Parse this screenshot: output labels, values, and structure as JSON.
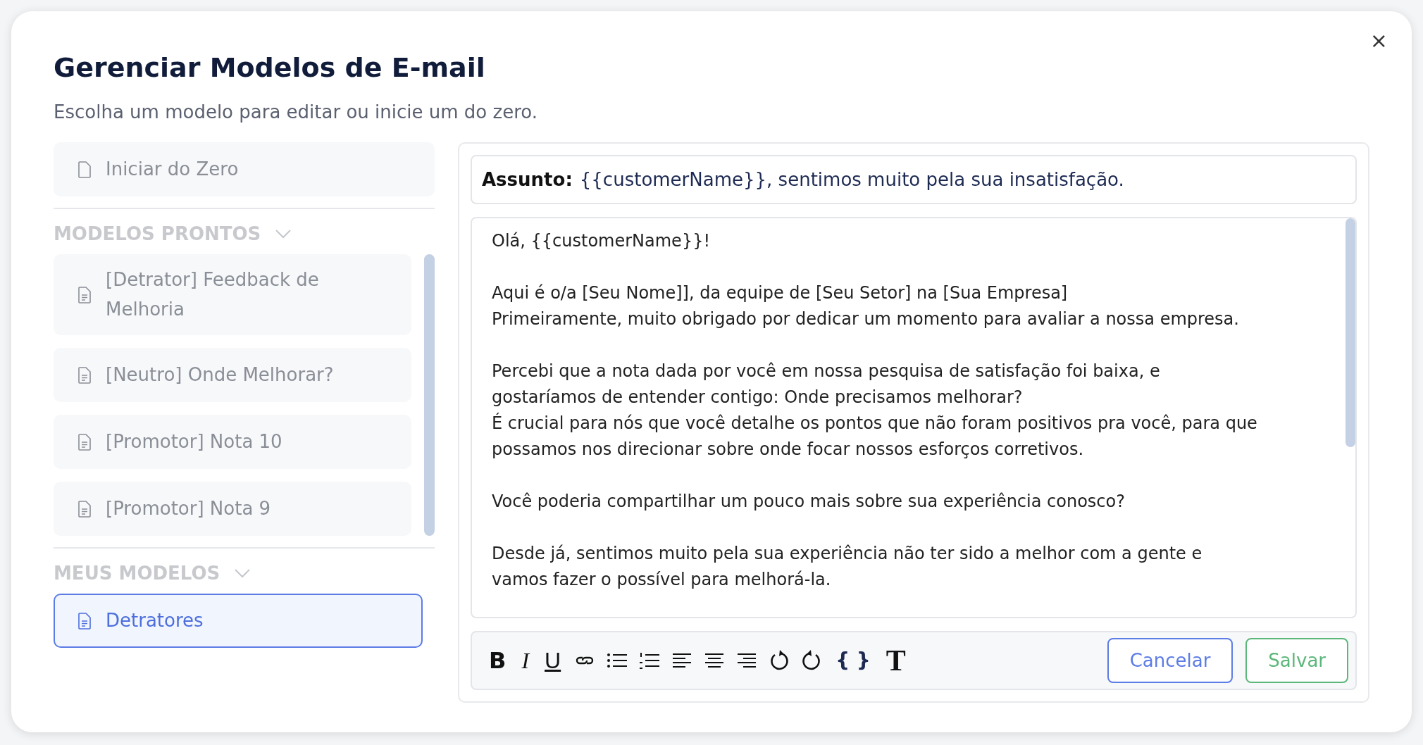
{
  "dialog": {
    "title": "Gerenciar Modelos de E-mail",
    "subtitle": "Escolha um modelo para editar ou inicie um do zero.",
    "close": "×"
  },
  "start_item": {
    "label": "Iniciar do Zero",
    "selected": false
  },
  "sections": [
    {
      "title": "MODELOS PRONTOS",
      "expanded": true,
      "scrollable": true,
      "items": [
        {
          "label": "[Detrator] Feedback de Melhoria",
          "selected": false
        },
        {
          "label": "[Neutro] Onde Melhorar?",
          "selected": false
        },
        {
          "label": "[Promotor] Nota 10",
          "selected": false
        },
        {
          "label": "[Promotor] Nota 9",
          "selected": false
        }
      ]
    },
    {
      "title": "MEUS MODELOS",
      "expanded": true,
      "scrollable": false,
      "items": [
        {
          "label": "Detratores",
          "selected": true
        }
      ]
    }
  ],
  "editor": {
    "subject_label": "Assunto:",
    "subject": "{{customerName}}, sentimos muito pela sua insatisfação.",
    "body": [
      [
        "Olá, {{customerName}}!"
      ],
      [
        "Aqui é o/a [Seu Nome]], da equipe de [Seu Setor]  na [Sua Empresa]",
        "Primeiramente, muito obrigado por dedicar um momento para avaliar a nossa empresa."
      ],
      [
        "Percebi que a nota dada por você em nossa pesquisa de satisfação foi baixa, e",
        "gostaríamos de entender contigo: Onde precisamos melhorar?",
        "É crucial para nós que você detalhe os pontos que não foram positivos pra você, para que",
        "possamos nos direcionar sobre onde focar nossos esforços corretivos."
      ],
      [
        "Você poderia compartilhar um pouco mais sobre sua experiência conosco?"
      ],
      [
        "Desde já, sentimos muito pela sua experiência não ter sido a melhor com a gente e",
        "vamos fazer o possível para melhorá-la."
      ]
    ],
    "toolbar": [
      {
        "kind": "bold",
        "label": "B"
      },
      {
        "kind": "italic",
        "label": "I"
      },
      {
        "kind": "underline",
        "label": "U"
      },
      {
        "kind": "link"
      },
      {
        "kind": "bullet-list"
      },
      {
        "kind": "numbered-list"
      },
      {
        "kind": "align-left"
      },
      {
        "kind": "align-center"
      },
      {
        "kind": "align-right"
      },
      {
        "kind": "undo"
      },
      {
        "kind": "redo"
      },
      {
        "kind": "code",
        "label": "{ }"
      },
      {
        "kind": "font",
        "label": "T"
      }
    ],
    "buttons": [
      {
        "kind": "cancel",
        "label": "Cancelar"
      },
      {
        "kind": "save",
        "label": "Salvar"
      }
    ]
  }
}
